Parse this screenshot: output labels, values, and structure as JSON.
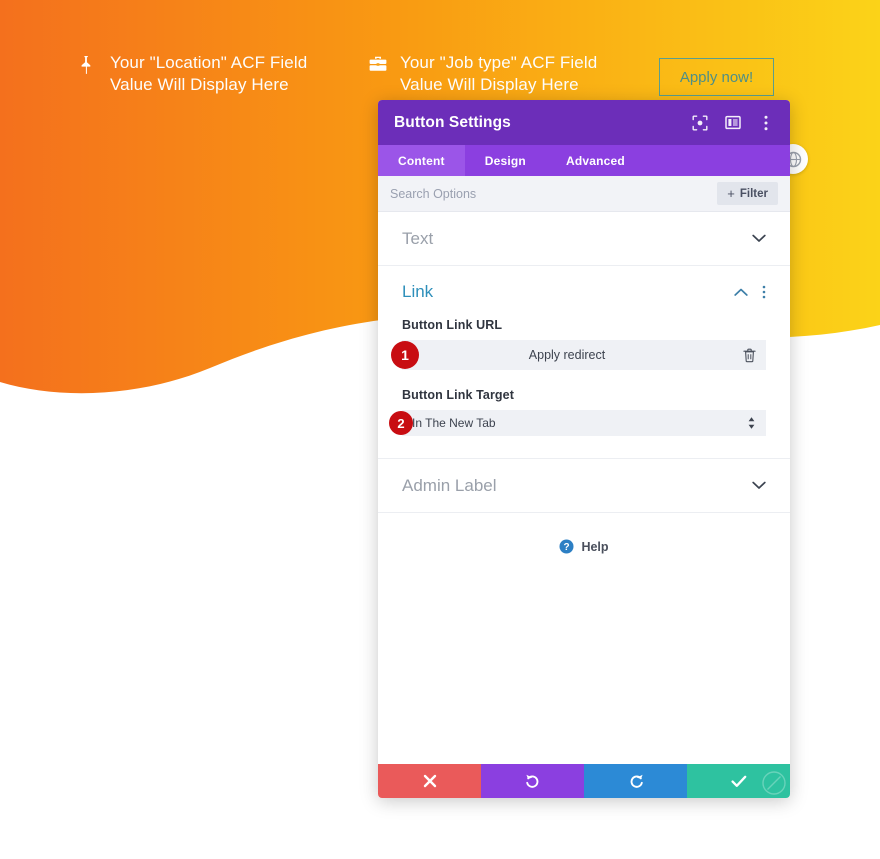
{
  "hero": {
    "gradient_from": "#f4701d",
    "gradient_to": "#fbd318",
    "meta": [
      {
        "icon": "map-pin-icon",
        "text": "Your \"Location\" ACF Field\nValue Will Display Here"
      },
      {
        "icon": "briefcase-icon",
        "text": "Your \"Job type\" ACF Field\nValue Will Display Here"
      }
    ],
    "apply_button": {
      "label": "Apply now!",
      "border_color": "#5a9e8e",
      "text_color": "#4e8f86"
    },
    "globe_bubble_icon": "globe-icon"
  },
  "panel": {
    "title": "Button Settings",
    "accent": "#6c2eb9",
    "header_icons": [
      {
        "name": "focus-target-icon"
      },
      {
        "name": "layout-columns-icon"
      },
      {
        "name": "vertical-dots-icon"
      }
    ],
    "tabs": [
      {
        "label": "Content",
        "active": true
      },
      {
        "label": "Design",
        "active": false
      },
      {
        "label": "Advanced",
        "active": false
      }
    ],
    "search": {
      "placeholder": "Search Options",
      "value": "",
      "filter_label": "Filter",
      "filter_plus": "+"
    },
    "sections": {
      "text": {
        "title": "Text",
        "state": "collapsed"
      },
      "link": {
        "title": "Link",
        "state": "expanded",
        "accent": "#2e8fba",
        "fields": [
          {
            "label": "Button Link URL",
            "value": "Apply redirect",
            "badge": "1",
            "trash_icon": "trash-icon"
          },
          {
            "label": "Button Link Target",
            "value": "In The New Tab",
            "badge": "2",
            "arrows_icon": "select-arrows-icon"
          }
        ]
      },
      "admin_label": {
        "title": "Admin Label",
        "state": "collapsed"
      }
    },
    "help": {
      "label": "Help",
      "icon": "question-circle-icon"
    },
    "footer_buttons": [
      {
        "name": "cancel",
        "icon": "x-icon",
        "color": "#ea5a5a"
      },
      {
        "name": "undo",
        "icon": "undo-arrow-icon",
        "color": "#8b3fe0"
      },
      {
        "name": "redo",
        "icon": "redo-arrow-icon",
        "color": "#2c8ad6"
      },
      {
        "name": "save",
        "icon": "check-icon",
        "color": "#2ec2a0"
      }
    ]
  }
}
